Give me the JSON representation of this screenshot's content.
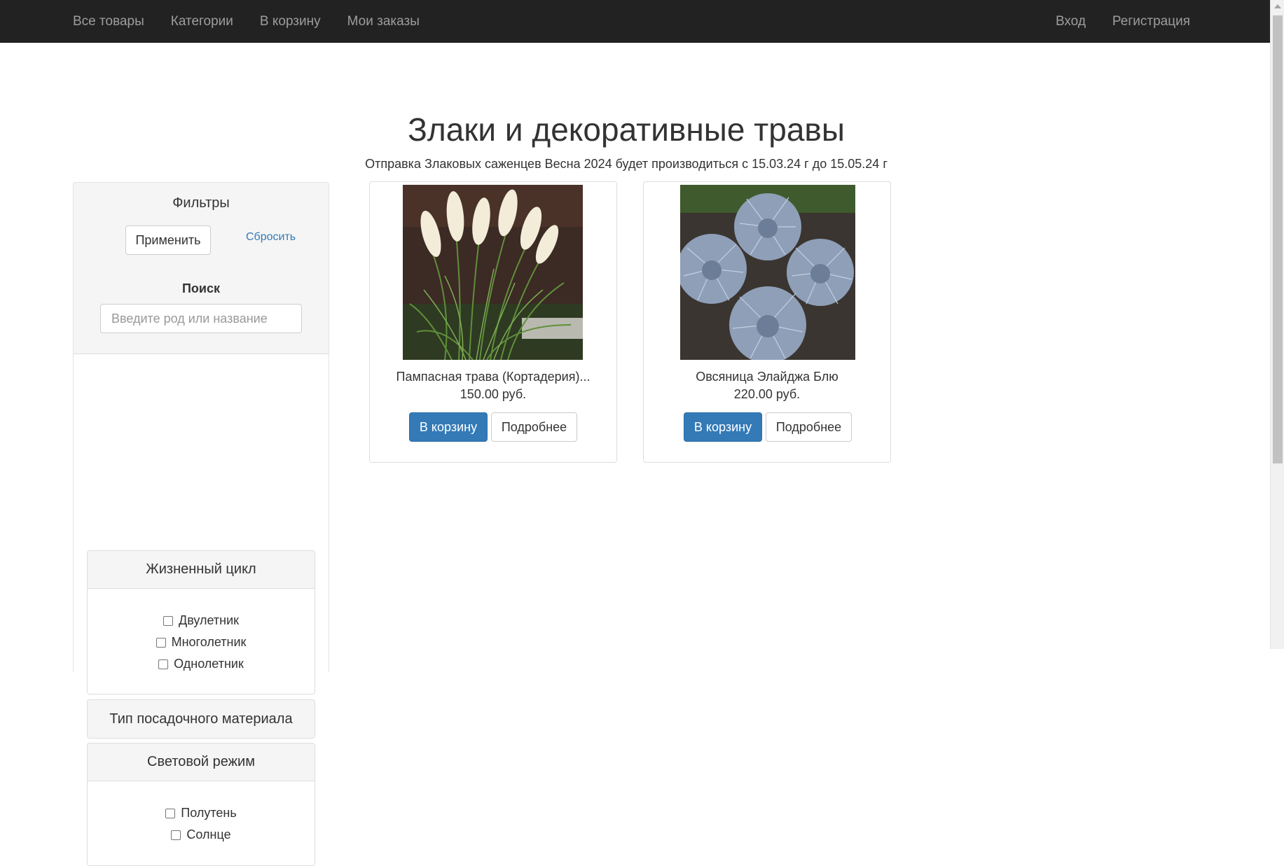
{
  "nav": {
    "left": [
      "Все товары",
      "Категории",
      "В корзину",
      "Мои заказы"
    ],
    "right": [
      "Вход",
      "Регистрация"
    ]
  },
  "page": {
    "title": "Злаки и декоративные травы",
    "subtitle": "Отправка Злаковых саженцев Весна 2024 будет производиться с 15.03.24 г до 15.05.24 г"
  },
  "sidebar": {
    "filters_title": "Фильтры",
    "apply_label": "Применить",
    "reset_label": "Сбросить",
    "search_label": "Поиск",
    "search_placeholder": "Введите род или название",
    "panels": [
      {
        "title": "Жизненный цикл",
        "options": [
          "Двулетник",
          "Многолетник",
          "Однолетник"
        ]
      },
      {
        "title": "Тип посадочного материала",
        "options": []
      },
      {
        "title": "Световой режим",
        "options": [
          "Полутень",
          "Солнце"
        ]
      }
    ]
  },
  "products": [
    {
      "name": "Пампасная трава (Кортадерия)...",
      "price": "150.00 руб.",
      "cart_label": "В корзину",
      "more_label": "Подробнее",
      "image": "pampas-grass-photo"
    },
    {
      "name": "Овсяница Элайджа Блю",
      "price": "220.00 руб.",
      "cart_label": "В корзину",
      "more_label": "Подробнее",
      "image": "blue-fescue-photo"
    }
  ],
  "colors": {
    "navbar": "#222222",
    "nav_link": "#9d9d9d",
    "primary": "#337ab7",
    "link": "#337ab7"
  }
}
